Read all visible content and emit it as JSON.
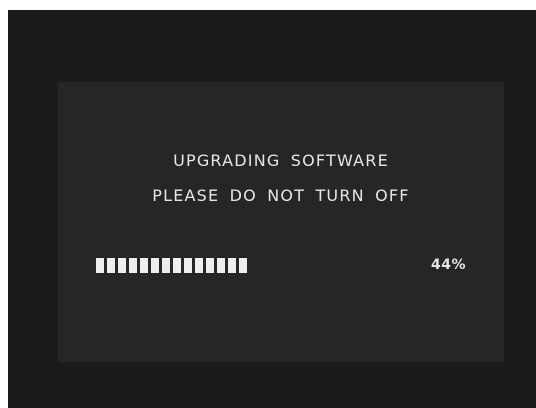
{
  "screen": {
    "title_line1": "UPGRADING SOFTWARE",
    "title_line2": "PLEASE DO NOT TURN OFF",
    "progress": {
      "percent_text": "44%",
      "value": 0.44,
      "segments_total": 32,
      "segments_filled": 14
    },
    "colors": {
      "outer_background": "#1b1b1b",
      "panel_background": "#262626",
      "text": "#e6e6e6",
      "bar_fill": "#eeeeee"
    }
  }
}
